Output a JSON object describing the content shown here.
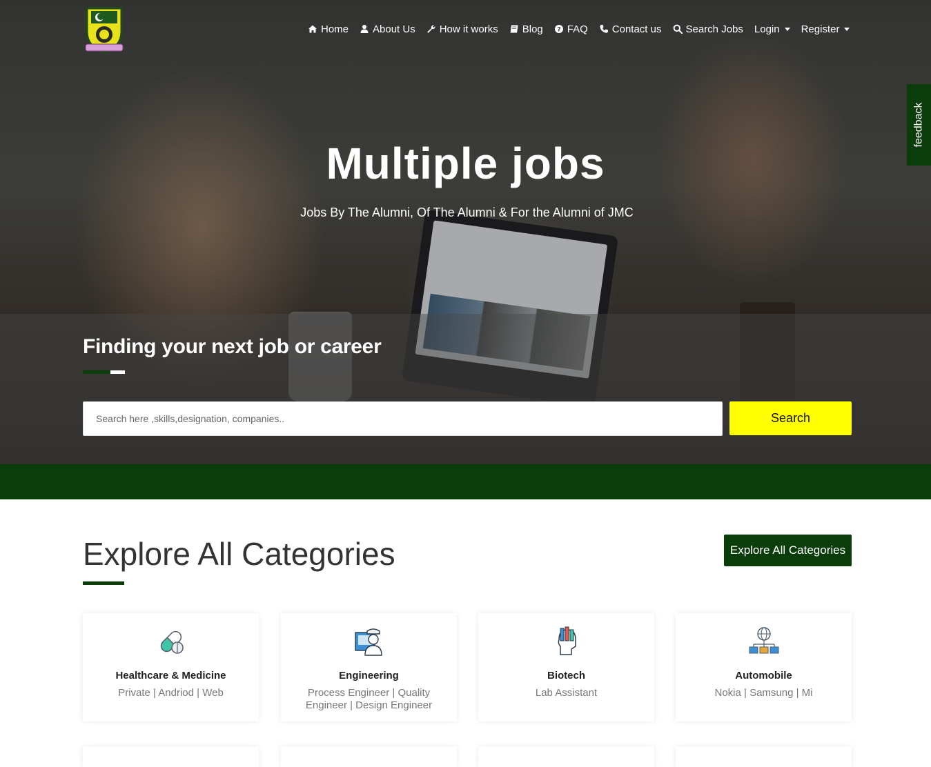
{
  "nav": {
    "items": [
      {
        "label": "Home",
        "icon": "home-icon"
      },
      {
        "label": "About Us",
        "icon": "user-icon"
      },
      {
        "label": "How it works",
        "icon": "wrench-icon"
      },
      {
        "label": "Blog",
        "icon": "book-icon"
      },
      {
        "label": "FAQ",
        "icon": "question-circle-icon"
      },
      {
        "label": "Contact us",
        "icon": "phone-icon"
      },
      {
        "label": "Search Jobs",
        "icon": "search-icon"
      }
    ],
    "login": "Login",
    "register": "Register"
  },
  "feedback": "feedback",
  "hero": {
    "title": "Multiple jobs",
    "subtitle": "Jobs By The Alumni, Of The Alumni & For the Alumni of JMC"
  },
  "search": {
    "heading": "Finding your next job or career",
    "placeholder": "Search here ,skills,designation, companies..",
    "button": "Search"
  },
  "categories": {
    "title": "Explore All Categories",
    "button": "Explore All Categories",
    "items": [
      {
        "name": "Healthcare & Medicine",
        "sub": "Private | Andriod | Web",
        "icon": "capsule-icon"
      },
      {
        "name": "Engineering",
        "sub": "Process Engineer | Quality Engineer | Design Engineer",
        "icon": "engineer-icon"
      },
      {
        "name": "Biotech",
        "sub": "Lab Assistant",
        "icon": "lab-tubes-icon"
      },
      {
        "name": "Automobile",
        "sub": "Nokia | Samsung | Mi",
        "icon": "network-globe-icon"
      }
    ]
  },
  "colors": {
    "brand_green": "#0b3d0b",
    "search_button": "#ffff00",
    "white": "#ffffff"
  }
}
